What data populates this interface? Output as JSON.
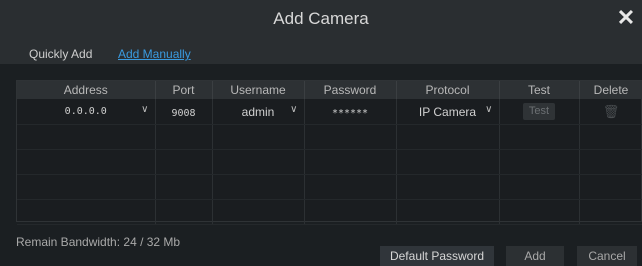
{
  "dialog": {
    "title": "Add Camera",
    "close_glyph": "✕"
  },
  "tabs": [
    {
      "label": "Quickly Add"
    },
    {
      "label": "Add Manually"
    }
  ],
  "table": {
    "headers": [
      "Address",
      "Port",
      "Username",
      "Password",
      "Protocol",
      "Test",
      "Delete"
    ],
    "row": {
      "address": "0.0.0.0",
      "port": "9008",
      "username": "admin",
      "password": "******",
      "protocol": "IP Camera",
      "test_label": "Test",
      "delete_icon": "trash-icon"
    }
  },
  "footer": {
    "bandwidth": "Remain Bandwidth: 24 / 32 Mb",
    "buttons": {
      "default_password": "Default Password",
      "add": "Add",
      "cancel": "Cancel"
    }
  }
}
